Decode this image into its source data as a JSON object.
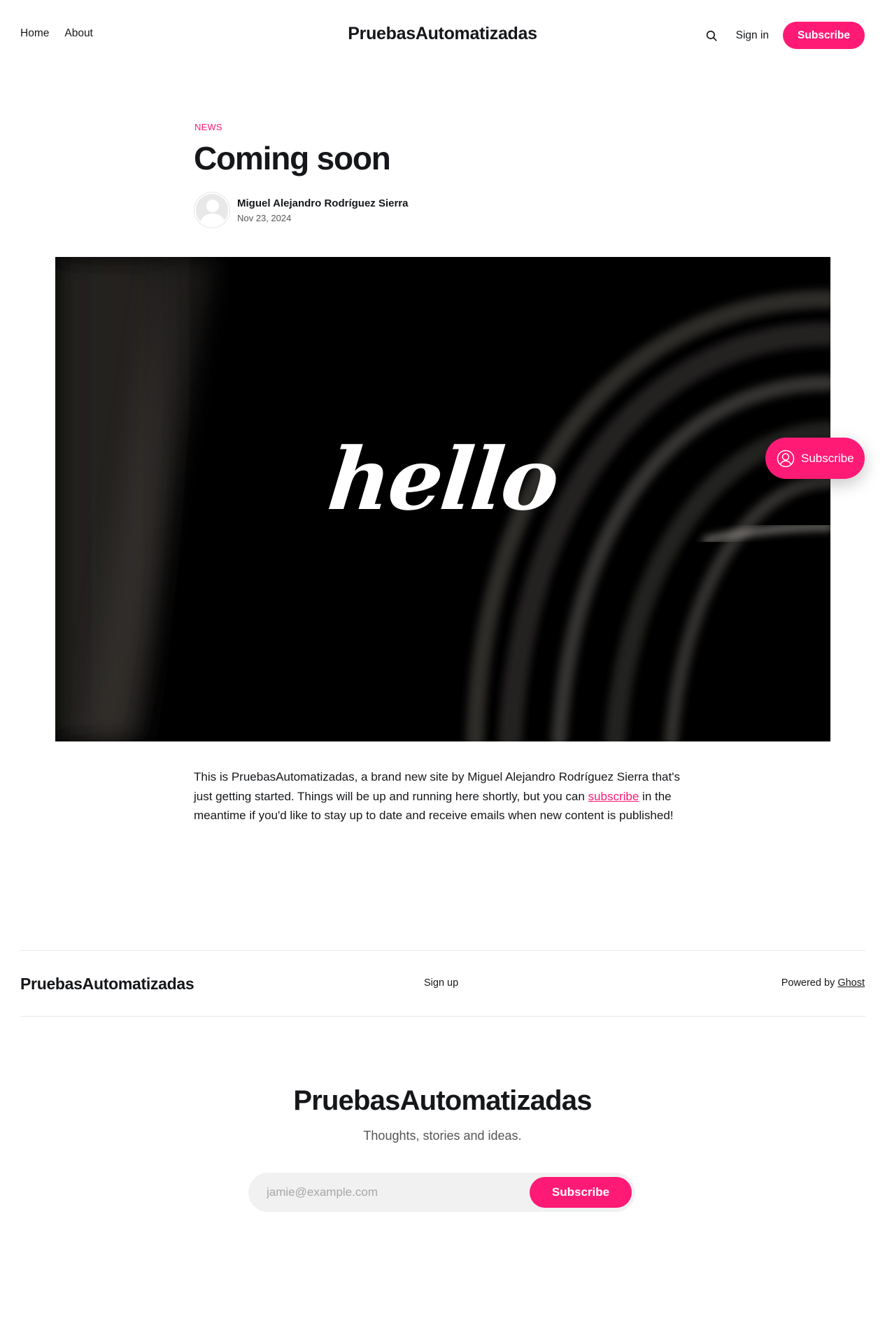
{
  "header": {
    "nav": [
      {
        "label": "Home"
      },
      {
        "label": "About"
      }
    ],
    "site_title": "PruebasAutomatizadas",
    "sign_in_label": "Sign in",
    "subscribe_label": "Subscribe",
    "search_icon": "search-icon"
  },
  "post": {
    "tag": "NEWS",
    "title": "Coming soon",
    "author": "Miguel Alejandro Rodríguez Sierra",
    "date": "Nov 23, 2024",
    "feature_image_text": "hello",
    "body_before_link": "This is PruebasAutomatizadas, a brand new site by Miguel Alejandro Rodríguez Sierra that's just getting started. Things will be up and running here shortly, but you can ",
    "body_link": "subscribe",
    "body_after_link": " in the meantime if you'd like to stay up to date and receive emails when new content is published!"
  },
  "portal": {
    "label": "Subscribe",
    "icon": "user-circle-icon"
  },
  "footer": {
    "site_title": "PruebasAutomatizadas",
    "signup_label": "Sign up",
    "powered_prefix": "Powered by",
    "powered_link": "Ghost"
  },
  "cta": {
    "title": "PruebasAutomatizadas",
    "description": "Thoughts, stories and ideas.",
    "email_placeholder": "jamie@example.com",
    "button_label": "Subscribe"
  },
  "colors": {
    "accent": "#ff1a75",
    "text": "#15171a",
    "feature_bg": "#000000"
  }
}
